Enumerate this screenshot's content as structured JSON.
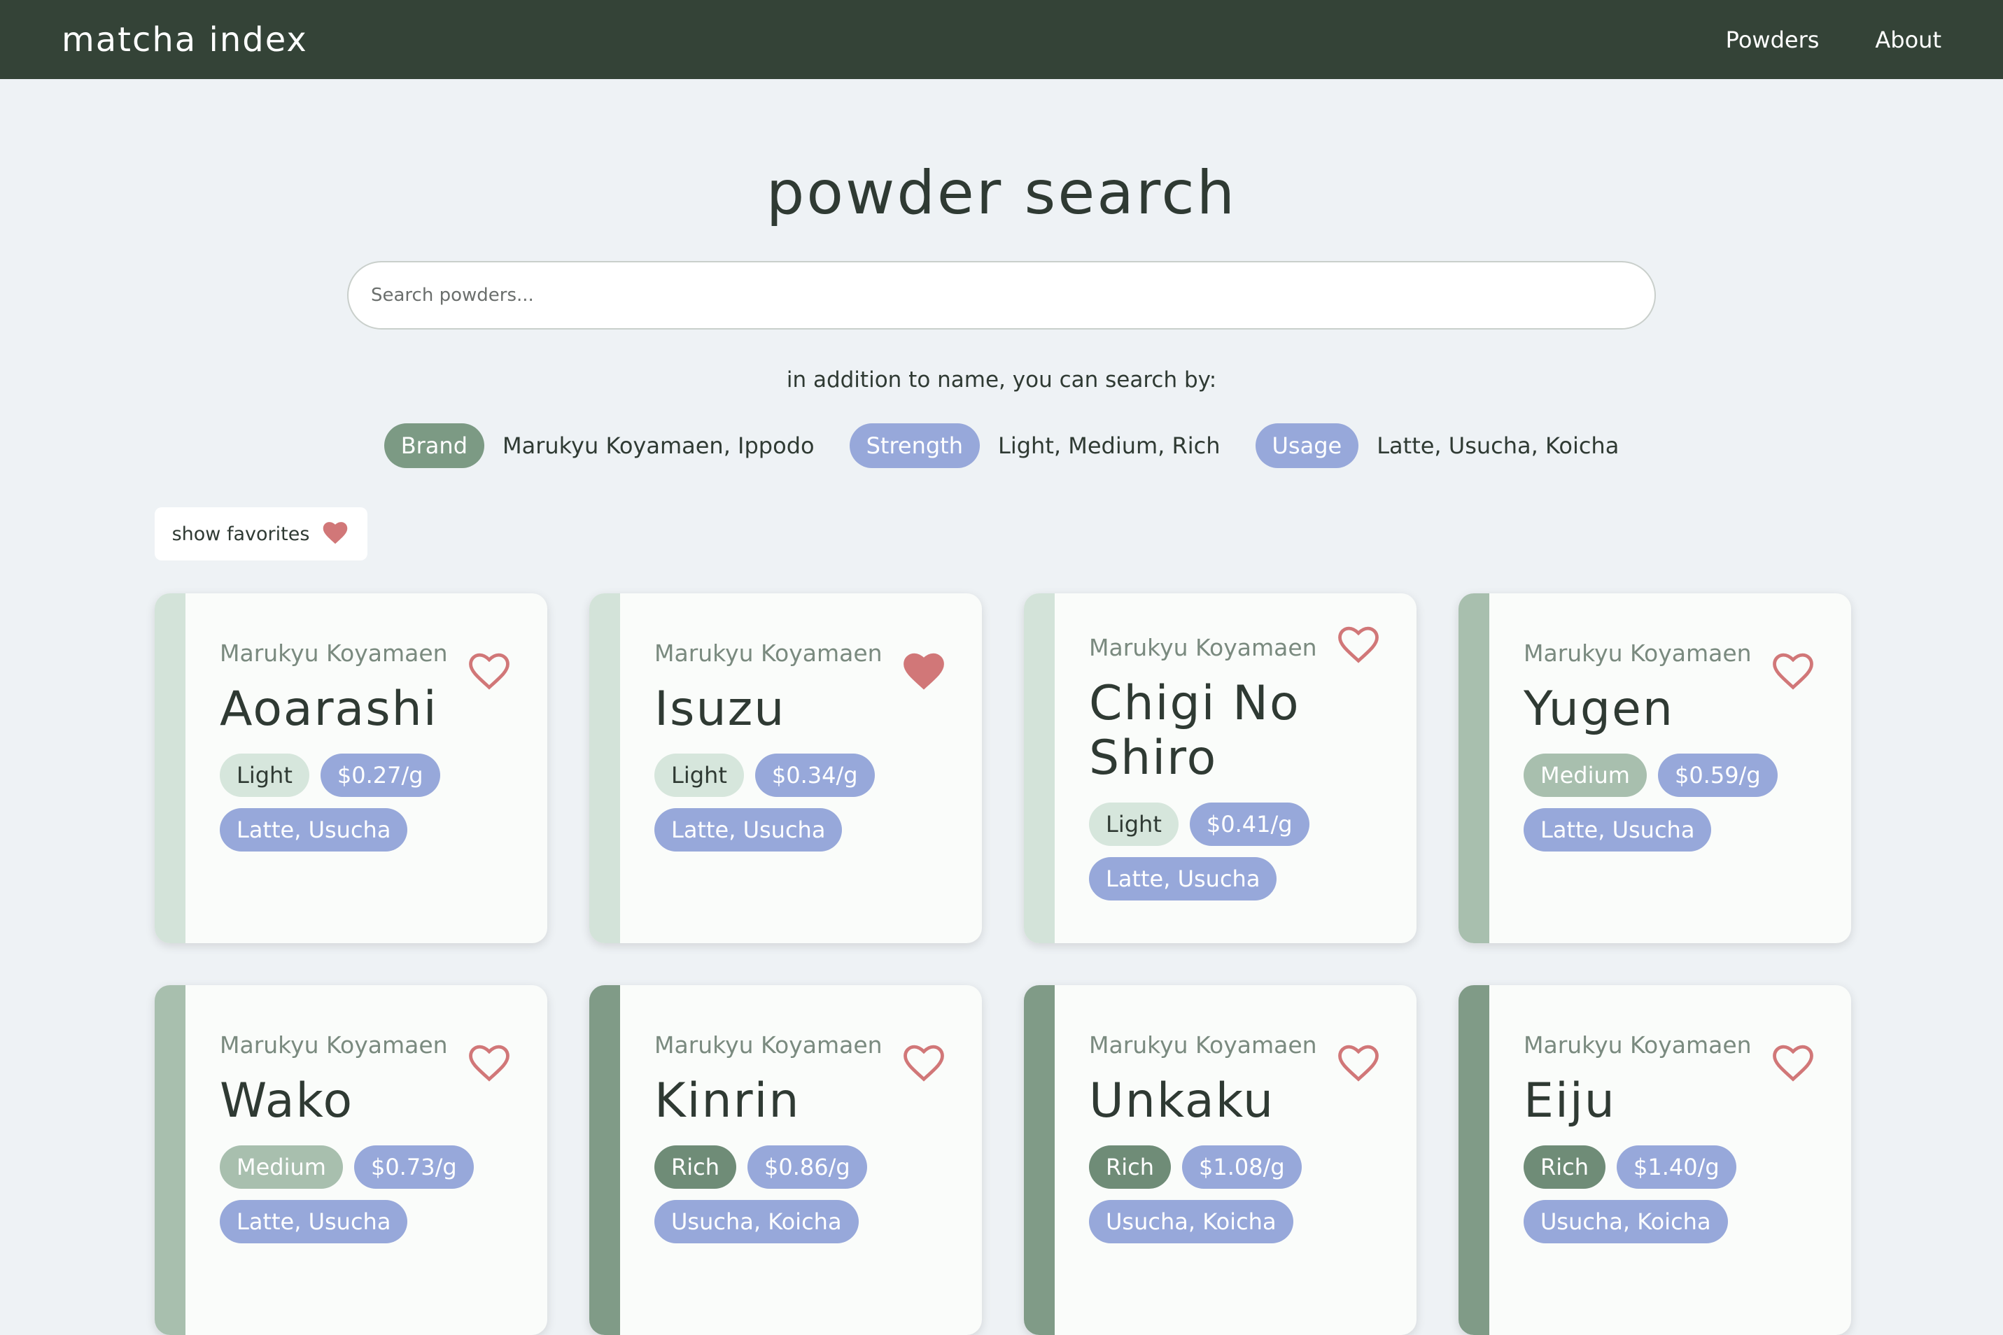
{
  "nav": {
    "brand": "matcha index",
    "links": [
      "Powders",
      "About"
    ]
  },
  "page": {
    "title": "powder search",
    "search_placeholder": "Search powders...",
    "hint": "in addition to name, you can search by:"
  },
  "filters": [
    {
      "label": "Brand",
      "values": "Marukyu Koyamaen, Ippodo",
      "color": "#7c9a84"
    },
    {
      "label": "Strength",
      "values": "Light, Medium, Rich",
      "color": "#97a8da"
    },
    {
      "label": "Usage",
      "values": "Latte, Usucha, Koicha",
      "color": "#97a8da"
    }
  ],
  "favorites_toggle": {
    "label": "show favorites"
  },
  "colors": {
    "navbar": "#344337",
    "background": "#eef2f5",
    "heart": "#d17778",
    "price_tag": "#97a8da"
  },
  "cards": [
    {
      "brand": "Marukyu Koyamaen",
      "name": "Aoarashi",
      "strength": "Light",
      "price": "$0.27/g",
      "usage": "Latte, Usucha",
      "favorite": false
    },
    {
      "brand": "Marukyu Koyamaen",
      "name": "Isuzu",
      "strength": "Light",
      "price": "$0.34/g",
      "usage": "Latte, Usucha",
      "favorite": true
    },
    {
      "brand": "Marukyu Koyamaen",
      "name": "Chigi No Shiro",
      "strength": "Light",
      "price": "$0.41/g",
      "usage": "Latte, Usucha",
      "favorite": false
    },
    {
      "brand": "Marukyu Koyamaen",
      "name": "Yugen",
      "strength": "Medium",
      "price": "$0.59/g",
      "usage": "Latte, Usucha",
      "favorite": false
    },
    {
      "brand": "Marukyu Koyamaen",
      "name": "Wako",
      "strength": "Medium",
      "price": "$0.73/g",
      "usage": "Latte, Usucha",
      "favorite": false
    },
    {
      "brand": "Marukyu Koyamaen",
      "name": "Kinrin",
      "strength": "Rich",
      "price": "$0.86/g",
      "usage": "Usucha, Koicha",
      "favorite": false
    },
    {
      "brand": "Marukyu Koyamaen",
      "name": "Unkaku",
      "strength": "Rich",
      "price": "$1.08/g",
      "usage": "Usucha, Koicha",
      "favorite": false
    },
    {
      "brand": "Marukyu Koyamaen",
      "name": "Eiju",
      "strength": "Rich",
      "price": "$1.40/g",
      "usage": "Usucha, Koicha",
      "favorite": false
    }
  ]
}
